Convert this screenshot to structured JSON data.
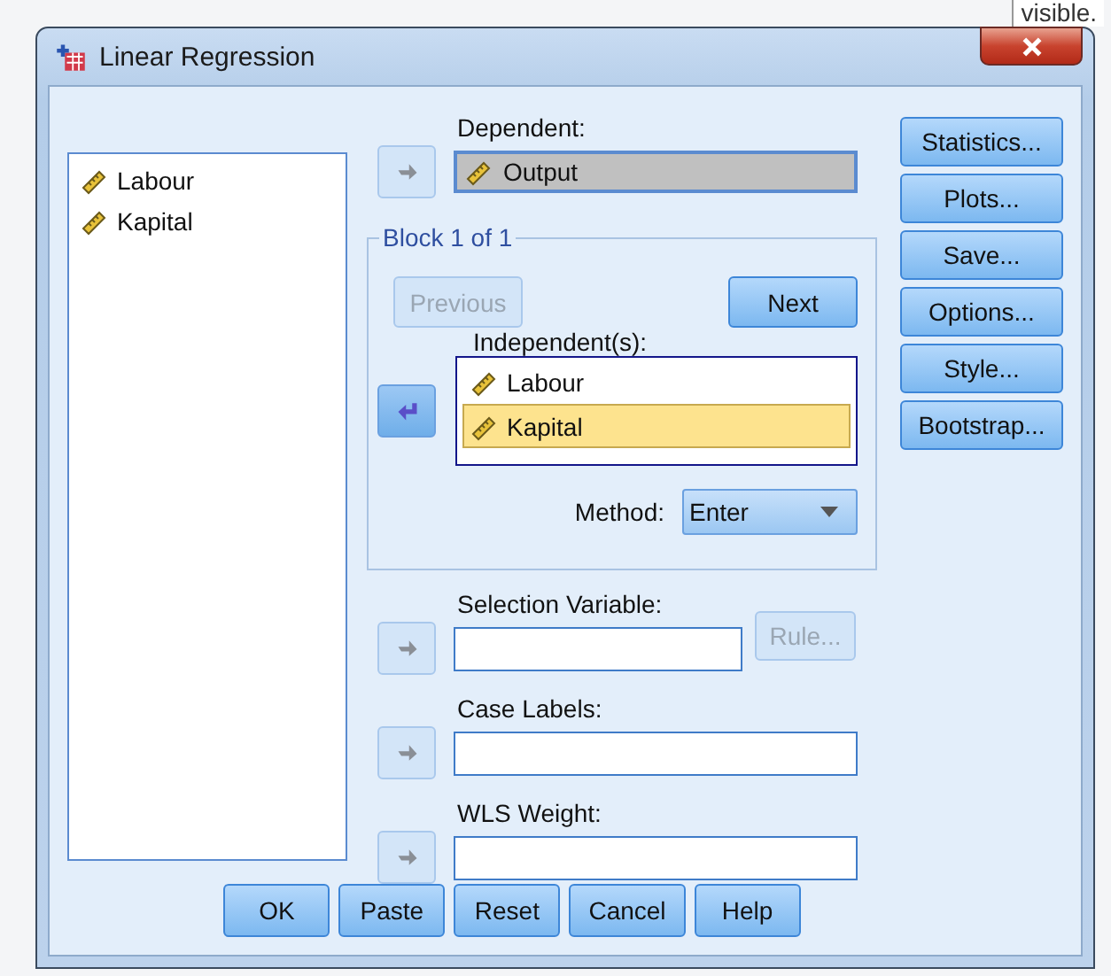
{
  "background_text": "visible.",
  "window": {
    "title": "Linear Regression"
  },
  "variables": [
    "Labour",
    "Kapital"
  ],
  "dependent": {
    "label": "Dependent:",
    "value": "Output",
    "arrow": {
      "kind": "right",
      "disabled": true
    }
  },
  "block": {
    "title": "Block 1 of 1",
    "buttons": [
      {
        "label": "Previous",
        "disabled": true
      },
      {
        "label": "Next",
        "disabled": false
      }
    ]
  },
  "independents": {
    "label": "Independent(s):",
    "arrow": {
      "kind": "left",
      "disabled": false
    },
    "items": [
      {
        "name": "Labour",
        "selected": false
      },
      {
        "name": "Kapital",
        "selected": true
      }
    ]
  },
  "method": {
    "label": "Method:",
    "value": "Enter"
  },
  "selection_variable": {
    "label": "Selection Variable:",
    "arrow": {
      "kind": "right",
      "disabled": true
    },
    "rule_button": {
      "label": "Rule...",
      "disabled": true
    }
  },
  "case_labels": {
    "label": "Case Labels:",
    "arrow": {
      "kind": "right",
      "disabled": true
    }
  },
  "wls_weight": {
    "label": "WLS Weight:",
    "arrow": {
      "kind": "right",
      "disabled": true
    }
  },
  "side_buttons": [
    "Statistics...",
    "Plots...",
    "Save...",
    "Options...",
    "Style...",
    "Bootstrap..."
  ],
  "buttons": [
    "OK",
    "Paste",
    "Reset",
    "Cancel",
    "Help"
  ]
}
